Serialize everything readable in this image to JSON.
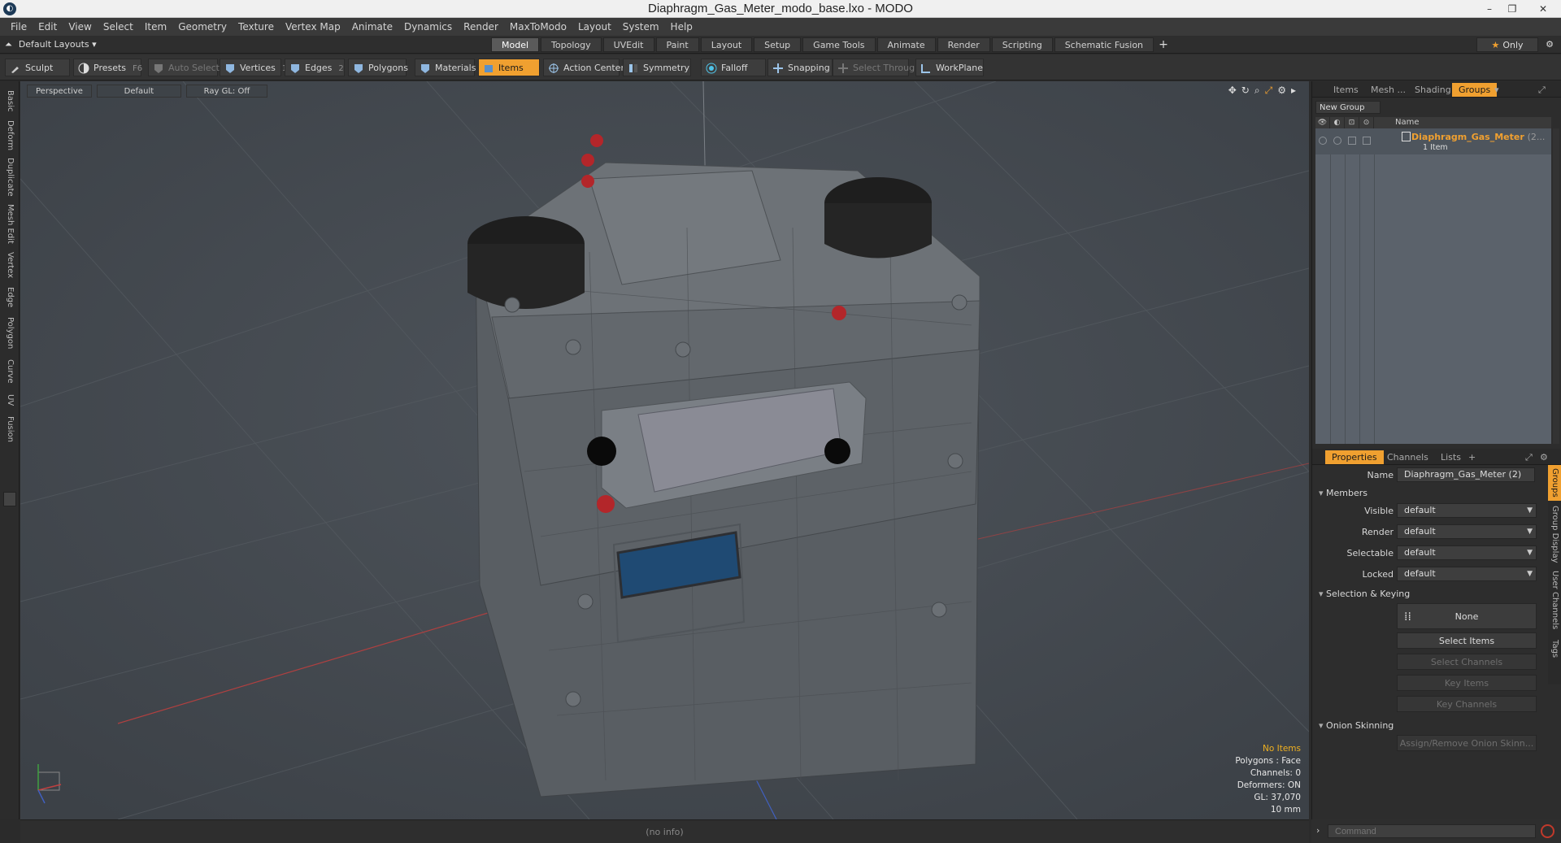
{
  "window": {
    "title": "Diaphragm_Gas_Meter_modo_base.lxo - MODO",
    "min": "–",
    "restore": "❐",
    "close": "✕"
  },
  "menu": [
    "File",
    "Edit",
    "View",
    "Select",
    "Item",
    "Geometry",
    "Texture",
    "Vertex Map",
    "Animate",
    "Dynamics",
    "Render",
    "MaxToModo",
    "Layout",
    "System",
    "Help"
  ],
  "layout": {
    "selector": "Default Layouts ▾",
    "only_label": "Only"
  },
  "tabs": [
    {
      "label": "Model",
      "active": true
    },
    {
      "label": "Topology"
    },
    {
      "label": "UVEdit"
    },
    {
      "label": "Paint"
    },
    {
      "label": "Layout"
    },
    {
      "label": "Setup"
    },
    {
      "label": "Game Tools"
    },
    {
      "label": "Animate"
    },
    {
      "label": "Render"
    },
    {
      "label": "Scripting"
    },
    {
      "label": "Schematic Fusion"
    }
  ],
  "toolbar": {
    "sculpt": "Sculpt",
    "presets": "Presets",
    "presets_key": "F6",
    "auto_select": "Auto Select",
    "vertices": "Vertices",
    "vertices_key": "1",
    "edges": "Edges",
    "edges_key": "2",
    "polygons": "Polygons",
    "materials": "Materials",
    "items": "Items",
    "action_center": "Action Center",
    "symmetry": "Symmetry",
    "falloff": "Falloff",
    "snapping": "Snapping",
    "select_through": "Select Through",
    "workplane": "WorkPlane"
  },
  "left_tabs": [
    "Basic",
    "Deform",
    "Duplicate",
    "Mesh Edit",
    "Vertex",
    "Edge",
    "Polygon",
    "Curve",
    "UV",
    "Fusion"
  ],
  "viewport": {
    "perspective": "Perspective",
    "shading": "Default",
    "raygl": "Ray GL: Off",
    "hud": {
      "no_items": "No Items",
      "polygons": "Polygons : Face",
      "channels": "Channels: 0",
      "deformers": "Deformers: ON",
      "gl": "GL: 37,070",
      "unit": "10 mm"
    }
  },
  "groups_panel": {
    "tabs": [
      "Items",
      "Mesh ...",
      "Shading",
      "Groups"
    ],
    "active_tab": "Groups",
    "new_group": "New Group",
    "name_header": "Name",
    "group_name": "Diaphragm_Gas_Meter",
    "group_suffix": "(2...",
    "group_sub": "1 Item"
  },
  "properties": {
    "tabs": [
      "Properties",
      "Channels",
      "Lists"
    ],
    "name_label": "Name",
    "name_value": "Diaphragm_Gas_Meter (2)",
    "members": "Members",
    "visible_label": "Visible",
    "visible_value": "default",
    "render_label": "Render",
    "render_value": "default",
    "selectable_label": "Selectable",
    "selectable_value": "default",
    "locked_label": "Locked",
    "locked_value": "default",
    "selection_keying": "Selection & Keying",
    "none": "None",
    "select_items": "Select Items",
    "select_channels": "Select Channels",
    "key_items": "Key Items",
    "key_channels": "Key Channels",
    "onion_skinning": "Onion Skinning",
    "assign_onion": "Assign/Remove Onion Skinn...",
    "right_tabs": [
      "Groups",
      "Group Display",
      "User Channels",
      "Tags"
    ]
  },
  "status": {
    "info": "(no info)",
    "command_placeholder": "Command"
  },
  "colors": {
    "accent": "#f0a030",
    "viewport_bg": "#464b51",
    "panel_bg": "#2d2d2d"
  }
}
